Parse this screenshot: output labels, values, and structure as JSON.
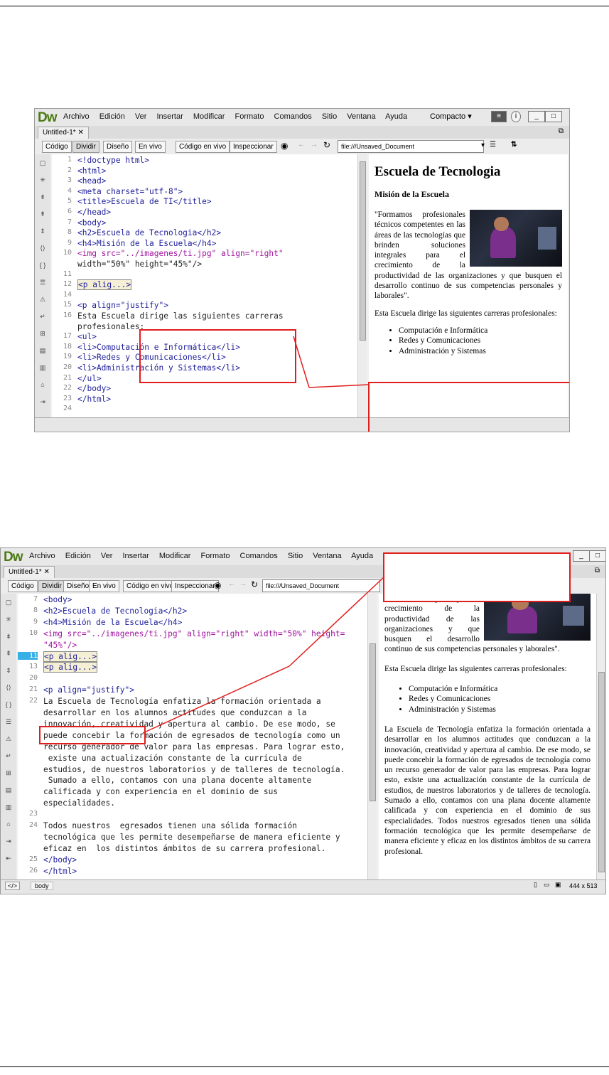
{
  "shot1": {
    "app_logo": "Dw",
    "menu": [
      "Archivo",
      "Edición",
      "Ver",
      "Insertar",
      "Modificar",
      "Formato",
      "Comandos",
      "Sitio",
      "Ventana",
      "Ayuda"
    ],
    "workspace": "Compacto",
    "workspace_arrow": "▾",
    "doc_tab": "Untitled-1*",
    "views": {
      "code": "Código",
      "split": "Dividir",
      "design": "Diseño",
      "live": "En vivo",
      "live_code": "Código en vivo",
      "inspect": "Inspeccionar"
    },
    "url": "file:///Unsaved_Document",
    "code_lines": [
      {
        "n": "1",
        "t": "<!doctype html>"
      },
      {
        "n": "2",
        "t": "<html>"
      },
      {
        "n": "3",
        "t": "<head>"
      },
      {
        "n": "4",
        "t": "<meta charset=\"utf-8\">"
      },
      {
        "n": "5",
        "t": "<title>Escuela de TI</title>"
      },
      {
        "n": "6",
        "t": "</head>"
      },
      {
        "n": "7",
        "t": "<body>"
      },
      {
        "n": "8",
        "t": "<h2>Escuela de Tecnologia</h2>"
      },
      {
        "n": "9",
        "t": "<h4>Misión de la Escuela</h4>"
      },
      {
        "n": "10",
        "t": "<img src=\"../imagenes/ti.jpg\" align=\"right\""
      },
      {
        "n": "",
        "t": "width=\"50%\" height=\"45%\"/>"
      },
      {
        "n": "11",
        "t": ""
      },
      {
        "n": "12",
        "t": "<p alig...>"
      },
      {
        "n": "14",
        "t": ""
      },
      {
        "n": "15",
        "t": "<p align=\"justify\">"
      },
      {
        "n": "16",
        "t": "Esta Escuela dirige las siguientes carreras"
      },
      {
        "n": "",
        "t": "profesionales:"
      },
      {
        "n": "17",
        "t": "<ul>"
      },
      {
        "n": "18",
        "t": "<li>Computación e Informática</li>"
      },
      {
        "n": "19",
        "t": "<li>Redes y Comunicaciones</li>"
      },
      {
        "n": "20",
        "t": "<li>Administración y Sistemas</li>"
      },
      {
        "n": "21",
        "t": "</ul>"
      },
      {
        "n": "22",
        "t": "</body>"
      },
      {
        "n": "23",
        "t": "</html>"
      },
      {
        "n": "24",
        "t": ""
      }
    ],
    "preview": {
      "h2": "Escuela de Tecnologia",
      "h4": "Misión de la Escuela",
      "quote": "\"Formamos profesionales técnicos competentes en las áreas de las tecnologías que brinden soluciones integrales para el crecimiento de la productividad de las organizaciones y que busquen el desarrollo continuo de sus competencias personales y laborales\".",
      "intro": "Esta Escuela dirige las siguientes carreras profesionales:",
      "list": [
        "Computación e Informática",
        "Redes y Comunicaciones",
        "Administración y Sistemas"
      ]
    }
  },
  "shot2": {
    "app_logo": "Dw",
    "menu": [
      "Archivo",
      "Edición",
      "Ver",
      "Insertar",
      "Modificar",
      "Formato",
      "Comandos",
      "Sitio",
      "Ventana",
      "Ayuda"
    ],
    "doc_tab": "Untitled-1*",
    "views": {
      "code": "Código",
      "split": "Dividir",
      "design": "Diseño",
      "live": "En vivo",
      "live_code": "Código en vivo",
      "inspect": "Inspeccionar"
    },
    "url": "file:///Unsaved_Document",
    "code_lines": [
      {
        "n": "7",
        "t": "<body>"
      },
      {
        "n": "8",
        "t": "<h2>Escuela de Tecnologia</h2>"
      },
      {
        "n": "9",
        "t": "<h4>Misión de la Escuela</h4>"
      },
      {
        "n": "10",
        "t": "<img src=\"../imagenes/ti.jpg\" align=\"right\" width=\"50%\" height="
      },
      {
        "n": "",
        "t": "\"45%\"/>"
      },
      {
        "n": "11",
        "t": "<p alig...>"
      },
      {
        "n": "13",
        "t": "<p alig...>"
      },
      {
        "n": "20",
        "t": ""
      },
      {
        "n": "21",
        "t": "<p align=\"justify\">"
      },
      {
        "n": "22",
        "t": "La Escuela de Tecnología enfatiza la formación orientada a"
      },
      {
        "n": "",
        "t": "desarrollar en los alumnos actitudes que conduzcan a la"
      },
      {
        "n": "",
        "t": "innovación, creatividad y apertura al cambio. De ese modo, se"
      },
      {
        "n": "",
        "t": "puede concebir la formación de egresados de tecnología como un"
      },
      {
        "n": "",
        "t": "recurso generador de valor para las empresas. Para lograr esto,"
      },
      {
        "n": "",
        "t": " existe una actualización constante de la currícula de"
      },
      {
        "n": "",
        "t": "estudios, de nuestros laboratorios y de talleres de tecnología."
      },
      {
        "n": "",
        "t": " Sumado a ello, contamos con una plana docente altamente"
      },
      {
        "n": "",
        "t": "calificada y con experiencia en el dominio de sus"
      },
      {
        "n": "",
        "t": "especialidades."
      },
      {
        "n": "23",
        "t": ""
      },
      {
        "n": "24",
        "t": "Todos nuestros  egresados tienen una sólida formación"
      },
      {
        "n": "",
        "t": "tecnológica que les permite desempeñarse de manera eficiente y"
      },
      {
        "n": "",
        "t": "eficaz en  los distintos ámbitos de su carrera profesional."
      },
      {
        "n": "25",
        "t": "</body>"
      },
      {
        "n": "26",
        "t": "</html>"
      }
    ],
    "preview": {
      "quote_tail": "soluciones integrales para el crecimiento de la productividad de las organizaciones y que busquen el desarrollo continuo de sus competencias personales y laborales\".",
      "intro": "Esta Escuela dirige las siguientes carreras profesionales:",
      "list": [
        "Computación e Informática",
        "Redes y Comunicaciones",
        "Administración y Sistemas"
      ],
      "para": "La Escuela de Tecnología enfatiza la formación orientada a desarrollar en los alumnos actitudes que conduzcan a la innovación, creatividad y apertura al cambio. De ese modo, se puede concebir la formación de egresados de tecnología como un recurso generador de valor para las empresas. Para lograr esto, existe una actualización constante de la currícula de estudios, de nuestros laboratorios y de talleres de tecnología. Sumado a ello, contamos con una plana docente altamente calificada y con experiencia en el dominio de sus especialidades. Todos nuestros egresados tienen una sólida formación tecnológica que les permite desempeñarse de manera eficiente y eficaz en los distintos ámbitos de su carrera profesional."
    },
    "status": {
      "tag_icon": "</>",
      "tag": "body",
      "size": "444 x 513"
    }
  },
  "colors": {
    "accent_red": "#e01e1e",
    "dw_green": "#4b7a12",
    "tag_blue": "#1e1e9a",
    "attr_purple": "#a0149f"
  }
}
